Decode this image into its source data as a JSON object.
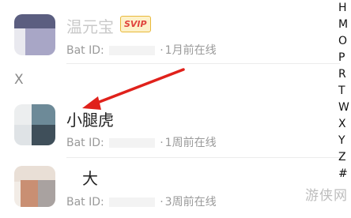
{
  "contacts": [
    {
      "name": "温元宝",
      "badge": "SVIP",
      "id_label": "Bat ID:",
      "status": "1月前在线"
    },
    {
      "name": "小腿虎",
      "id_label": "Bat ID:",
      "status": "1周前在线"
    },
    {
      "name": "大",
      "id_label": "Bat ID:",
      "status": "3周前在线"
    }
  ],
  "section_header": "X",
  "alphabet_index": [
    "H",
    "M",
    "O",
    "P",
    "R",
    "T",
    "W",
    "X",
    "Y",
    "Z",
    "#"
  ],
  "watermark": "游侠网",
  "colors": {
    "arrow": "#e0211b",
    "meta_text": "#9a9a9a",
    "vip_border": "#e8b93a"
  }
}
